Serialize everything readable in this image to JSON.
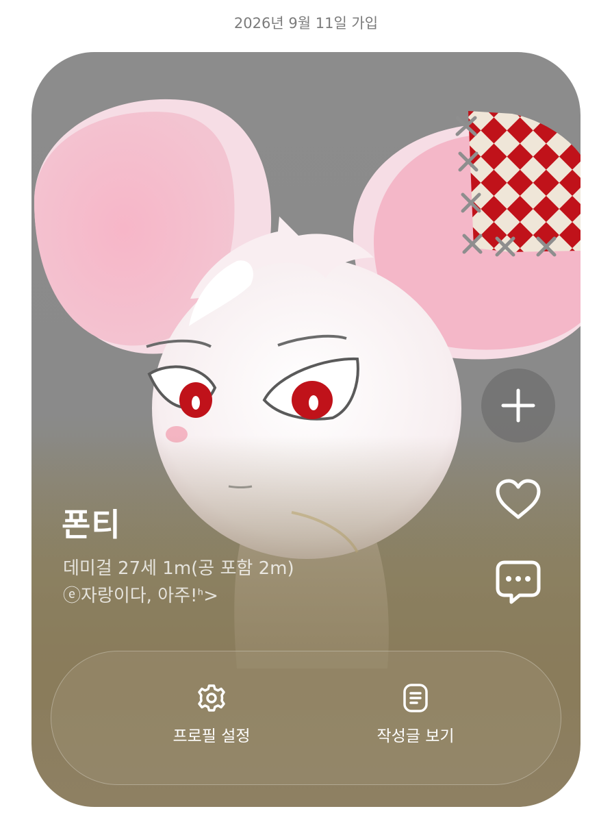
{
  "header": {
    "join_date": "2026년 9월 11일 가입"
  },
  "profile": {
    "name": "폰티",
    "description": "데미걸 27세 1m(공 포함 2m)",
    "status": "ⓔ자랑이다, 아주!ᑋ>"
  },
  "side_actions": {
    "add_icon": "plus-icon",
    "like_icon": "heart-icon",
    "chat_icon": "chat-bubble-icon"
  },
  "bottom_actions": [
    {
      "label": "프로필 설정",
      "icon": "gear-icon"
    },
    {
      "label": "작성글 보기",
      "icon": "document-icon"
    }
  ],
  "colors": {
    "card_top": "#8c8c8c",
    "card_bottom": "#8e8063",
    "accent_red": "#c0121a",
    "ear_pink": "#f2b8c9"
  }
}
